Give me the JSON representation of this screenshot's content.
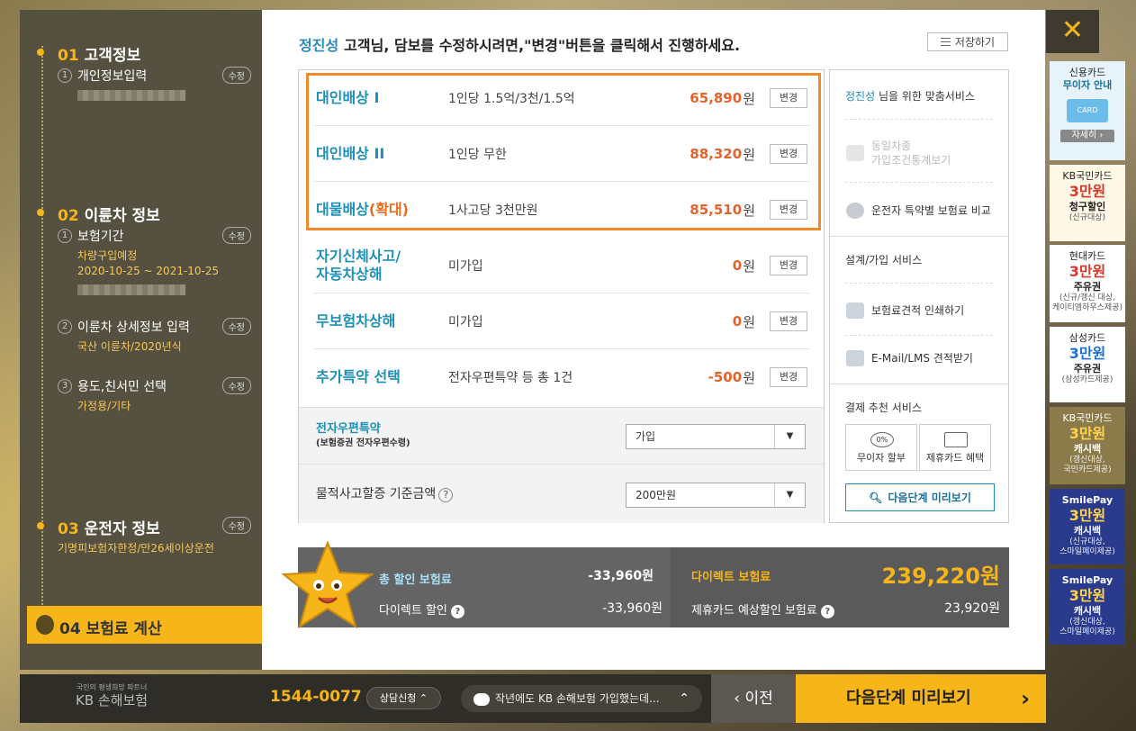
{
  "sidebar": {
    "step1": {
      "num": "01",
      "title": "고객정보",
      "sub1": {
        "n": "1",
        "label": "개인정보입력",
        "edit": "수정"
      }
    },
    "step2": {
      "num": "02",
      "title": "이륜차 정보",
      "sub1": {
        "n": "1",
        "label": "보험기간",
        "edit": "수정",
        "detail1": "차량구입예정",
        "detail2": "2020-10-25 ~ 2021-10-25"
      },
      "sub2": {
        "n": "2",
        "label": "이륜차 상세정보 입력",
        "edit": "수정",
        "detail1": "국산 이륜차/2020년식"
      },
      "sub3": {
        "n": "3",
        "label": "용도,친서민 선택",
        "edit": "수정",
        "detail1": "가정용/기타"
      }
    },
    "step3": {
      "num": "03",
      "title": "운전자 정보",
      "edit": "수정",
      "detail1": "기명피보험자한정/만26세이상운전"
    },
    "step4": {
      "num": "04",
      "title": "보험료 계산"
    }
  },
  "header": {
    "name": "정진성",
    "message": "고객님, 담보를 수정하시려면,\"변경\"버튼을 클릭해서 진행하세요.",
    "save_label": "저장하기"
  },
  "coverages": [
    {
      "name": "대인배상 I",
      "desc": "1인당 1.5억/3천/1.5억",
      "price": "65,890",
      "won": "원",
      "change": "변경"
    },
    {
      "name": "대인배상 II",
      "desc": "1인당 무한",
      "price": "88,320",
      "won": "원",
      "change": "변경"
    },
    {
      "name": "대물배상",
      "ext": "(확대)",
      "desc": "1사고당 3천만원",
      "price": "85,510",
      "won": "원",
      "change": "변경"
    },
    {
      "name": "자기신체사고/",
      "name2": "자동차상해",
      "desc": "미가입",
      "price": "0",
      "won": "원",
      "change": "변경"
    },
    {
      "name": "무보험차상해",
      "desc": "미가입",
      "price": "0",
      "won": "원",
      "change": "변경"
    },
    {
      "name": "추가특약 선택",
      "desc": "전자우편특약 등 총 1건",
      "price": "-500",
      "won": "원",
      "change": "변경"
    }
  ],
  "options": {
    "email": {
      "label": "전자우편특약",
      "sub": "(보험증권 전자우편수령)",
      "value": "가입"
    },
    "property": {
      "label": "물적사고할증 기준금액",
      "help": "?",
      "value": "200만원"
    }
  },
  "services": {
    "title_name": "정진성",
    "title_rest": " 님을 위한 맞춤서비스",
    "same_car1": "동일차종",
    "same_car2": "가입조건통계보기",
    "compare": "운전자 특약별 보험료 비교",
    "design_title": "설계/가입 서비스",
    "print": "보험료견적 인쇄하기",
    "email": "E-Mail/LMS 견적받기",
    "pay_title": "결제 추천 서비스",
    "no_interest": "무이자 할부",
    "card_benefit": "제휴카드 혜택",
    "card_icon_text": "0%",
    "preview": "다음단계 미리보기"
  },
  "total": {
    "discount_label": "총 할인 보험료",
    "discount_value": "-33,960원",
    "direct_label": "다이렉트 할인",
    "direct_value": "-33,960원",
    "premium_label": "다이렉트 보험료",
    "premium_value": "239,220원",
    "card_label": "제휴카드 예상할인 보험료",
    "card_value": "23,920원",
    "help": "?"
  },
  "banners": [
    {
      "l1": "신용카드",
      "l2": "무이자 안내",
      "card": "CARD",
      "more": "자세히 ›"
    },
    {
      "l1": "KB국민카드",
      "big": "3만원",
      "l3": "청구할인",
      "l4": "(신규대상)"
    },
    {
      "l1": "현대카드",
      "big": "3만원",
      "l3": "주유권",
      "l4": "(신규/갱신 대상,",
      "l5": "케이티엠하우스제공)"
    },
    {
      "l1": "삼성카드",
      "big": "3만원",
      "l3": "주유권",
      "l4": "(삼성카드제공)"
    },
    {
      "l1": "KB국민카드",
      "big": "3만원",
      "l3": "캐시백",
      "l4": "(갱신대상,",
      "l5": "국민카드제공)"
    },
    {
      "l1": "SmilePay",
      "big": "3만원",
      "l3": "캐시백",
      "l4": "(신규대상,",
      "l5": "스마일페이제공)"
    },
    {
      "l1": "SmilePay",
      "big": "3만원",
      "l3": "캐시백",
      "l4": "(갱신대상,",
      "l5": "스마일페이제공)"
    }
  ],
  "bottom": {
    "logo_tag": "국민의 평생희망 파트너",
    "logo": "KB 손해보험",
    "phone": "1544-0077",
    "consult": "상담신청 ⌃",
    "chat": "작년에도 KB 손해보험 가입했는데...",
    "chat_arrow": "⌃",
    "prev": "‹ 이전",
    "next": "다음단계 미리보기",
    "next_chev": "›"
  },
  "close": "✕",
  "colors": {
    "accent": "#f6b519",
    "blue": "#1e8fb5",
    "orange": "#e5632a",
    "sidebar": "#55503f"
  }
}
